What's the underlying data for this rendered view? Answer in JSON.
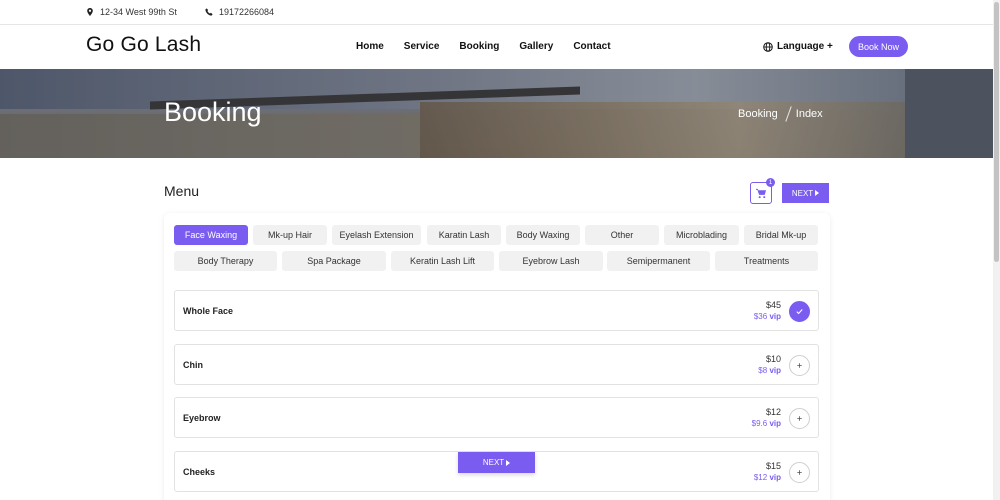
{
  "topbar": {
    "address": "12-34 West 99th St",
    "phone": "19172266084"
  },
  "header": {
    "logo": "Go Go Lash",
    "nav": [
      "Home",
      "Service",
      "Booking",
      "Gallery",
      "Contact"
    ],
    "language_label": "Language +",
    "book_now_label": "Book Now"
  },
  "hero": {
    "title": "Booking",
    "breadcrumb": [
      "Booking",
      "Index"
    ]
  },
  "menu": {
    "title": "Menu",
    "cart_count": "1",
    "next_label": "NEXT",
    "categories_row1": [
      "Face Waxing",
      "Mk-up Hair",
      "Eyelash Extension",
      "Karatin Lash",
      "Body Waxing",
      "Other",
      "Microblading",
      "Bridal Mk-up"
    ],
    "categories_row2": [
      "Body Therapy",
      "Spa Package",
      "Keratin Lash Lift",
      "Eyebrow Lash",
      "Semipermanent",
      "Treatments"
    ],
    "active_category": "Face Waxing",
    "items": [
      {
        "name": "Whole Face",
        "price": "$45",
        "vip_price": "$36",
        "vip_label": "vip",
        "selected": true
      },
      {
        "name": "Chin",
        "price": "$10",
        "vip_price": "$8",
        "vip_label": "vip",
        "selected": false
      },
      {
        "name": "Eyebrow",
        "price": "$12",
        "vip_price": "$9.6",
        "vip_label": "vip",
        "selected": false
      },
      {
        "name": "Cheeks",
        "price": "$15",
        "vip_price": "$12",
        "vip_label": "vip",
        "selected": false
      }
    ]
  },
  "colors": {
    "accent": "#7b5cf0",
    "chip": "#f1f1f1"
  }
}
